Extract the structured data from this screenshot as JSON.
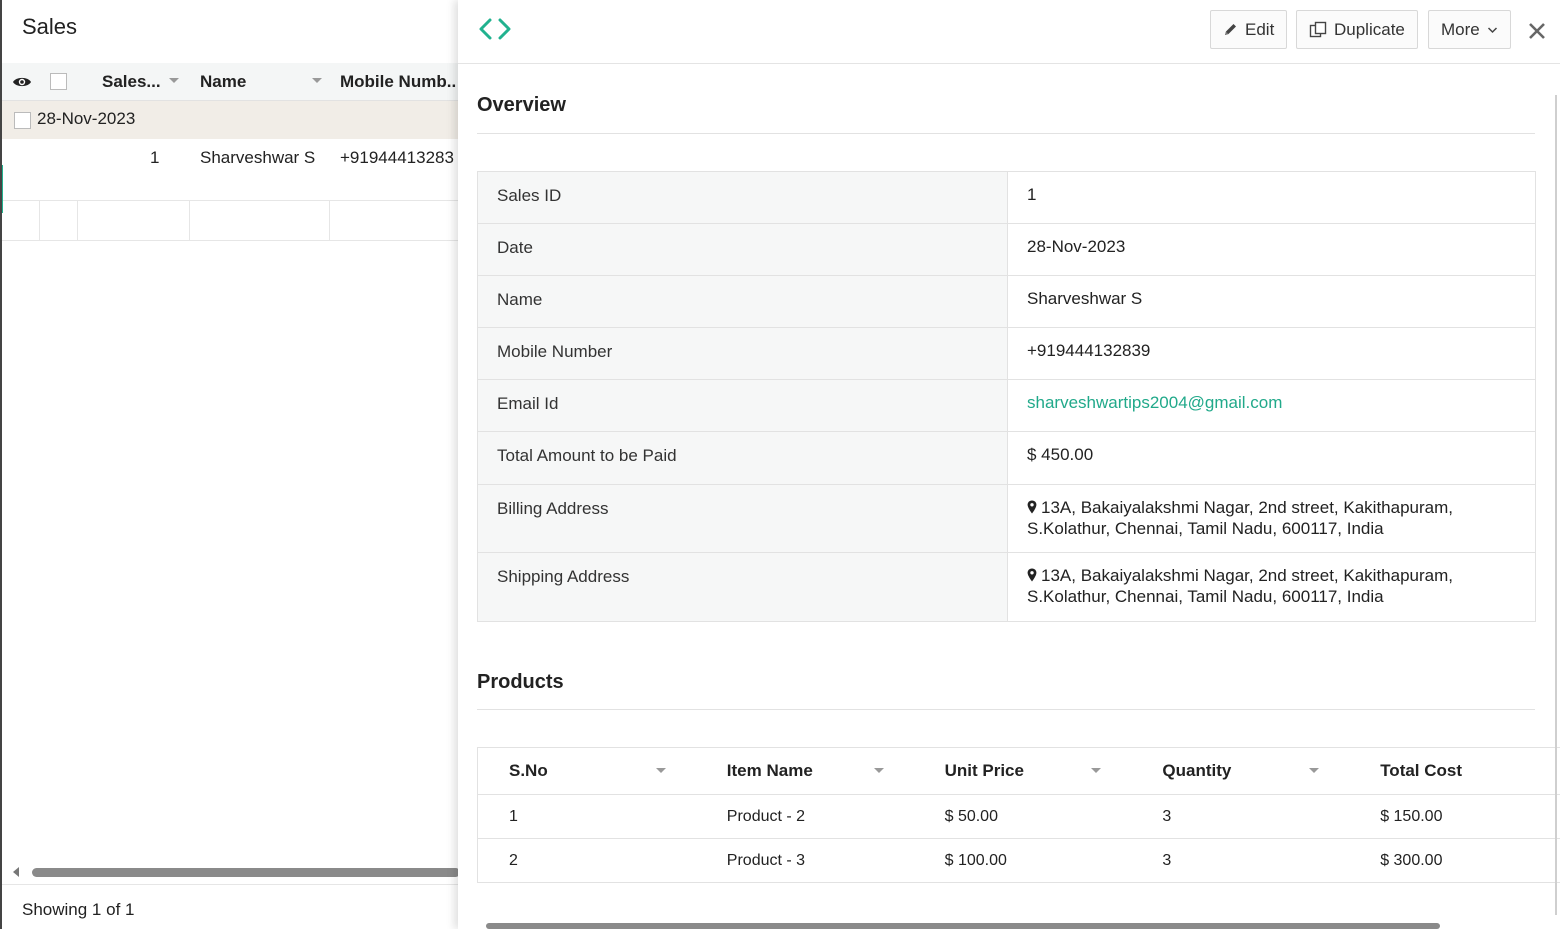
{
  "list": {
    "title": "Sales",
    "columns": [
      "Sales...",
      "Name",
      "Mobile Numb.."
    ],
    "group_label": "28-Nov-2023",
    "rows": [
      {
        "id": "1",
        "name": "Sharveshwar S",
        "mobile": "+91944413283"
      }
    ],
    "footer": "Showing 1 of 1"
  },
  "toolbar": {
    "edit_label": "Edit",
    "duplicate_label": "Duplicate",
    "more_label": "More"
  },
  "overview": {
    "title": "Overview",
    "fields": [
      {
        "label": "Sales ID",
        "value": "1"
      },
      {
        "label": "Date",
        "value": "28-Nov-2023"
      },
      {
        "label": "Name",
        "value": "Sharveshwar S"
      },
      {
        "label": "Mobile Number",
        "value": "+919444132839"
      },
      {
        "label": "Email Id",
        "value": "sharveshwartips2004@gmail.com"
      },
      {
        "label": "Total Amount to be Paid",
        "value": "$ 450.00"
      },
      {
        "label": "Billing Address",
        "value_line1": "13A, Bakaiyalakshmi Nagar, 2nd street, Kakithapuram,",
        "value_line2": "S.Kolathur, Chennai, Tamil Nadu, 600117, India"
      },
      {
        "label": "Shipping Address",
        "value_line1": "13A, Bakaiyalakshmi Nagar, 2nd street, Kakithapuram,",
        "value_line2": "S.Kolathur, Chennai, Tamil Nadu, 600117, India"
      }
    ]
  },
  "products": {
    "title": "Products",
    "columns": [
      "S.No",
      "Item Name",
      "Unit Price",
      "Quantity",
      "Total Cost"
    ],
    "rows": [
      [
        "1",
        "Product - 2",
        "$ 50.00",
        "3",
        "$ 150.00"
      ],
      [
        "2",
        "Product - 3",
        "$ 100.00",
        "3",
        "$ 300.00"
      ]
    ]
  },
  "colors": {
    "accent": "#21b28f",
    "link": "#21a98a",
    "group_bg": "#f1ede7"
  }
}
